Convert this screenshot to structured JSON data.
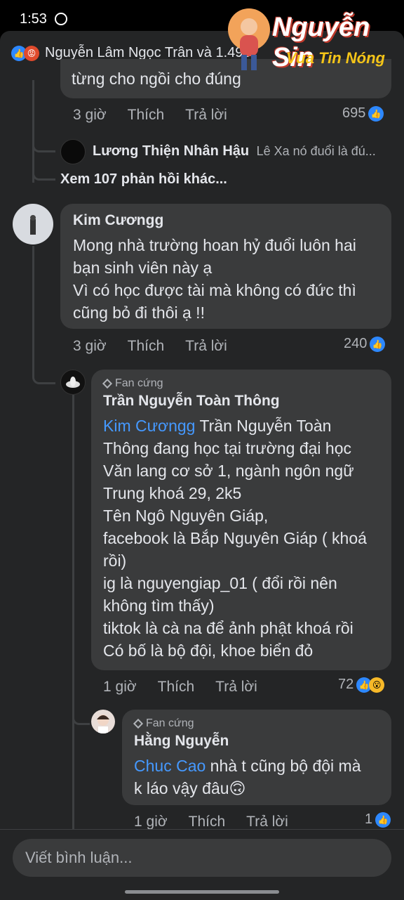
{
  "status_bar": {
    "time": "1:53"
  },
  "watermark": {
    "title": "Nguyễn Sin",
    "subtitle": "Vua Tin Nóng"
  },
  "header": {
    "reactors": "Nguyễn Lâm Ngọc Trân và 1.493"
  },
  "top_comment": {
    "partial_text": "từng cho ngồi cho đúng",
    "time": "3 giờ",
    "like": "Thích",
    "reply": "Trả lời",
    "count": "695"
  },
  "collapsed_reply": {
    "author": "Lương Thiện Nhân Hậu",
    "preview": "Lê Xa nó đuổi là đú..."
  },
  "more_replies": "Xem 107 phản hồi khác...",
  "comment1": {
    "author": "Kim Cươngg",
    "lines": [
      "Mong nhà trường hoan hỷ đuổi luôn hai",
      "bạn sinh viên này ạ",
      "Vì có học được tài mà không có đức thì",
      "cũng bỏ đi thôi ạ !!"
    ],
    "time": "3 giờ",
    "like": "Thích",
    "reply": "Trả lời",
    "count": "240"
  },
  "reply1": {
    "badge": "Fan cứng",
    "author": "Trần Nguyễn Toàn Thông",
    "mention": "Kim Cươngg",
    "first_line_rest": " Trần Nguyễn Toàn",
    "lines": [
      "Thông đang học tại trường đại học",
      "Văn lang cơ sở 1, ngành ngôn ngữ",
      "Trung khoá 29, 2k5",
      "Tên Ngô Nguyên Giáp,",
      "facebook là Bắp Nguyên Giáp ( khoá",
      "rồi)",
      "ig là nguyengiap_01 ( đổi rồi nên",
      "không tìm thấy)",
      "tiktok là cà na để ảnh phật khoá rồi",
      "Có bố là bộ đội, khoe biển đỏ"
    ],
    "time": "1 giờ",
    "like": "Thích",
    "reply": "Trả lời",
    "count": "72"
  },
  "reply2": {
    "badge": "Fan cứng",
    "author": "Hằng Nguyễn",
    "mention": "Chuc Cao",
    "first_line_rest": " nhà t cũng bộ đội mà",
    "line2": "k láo vậy đâu🙃",
    "time": "1 giờ",
    "like": "Thích",
    "reply": "Trả lời",
    "count": "1"
  },
  "input": {
    "placeholder": "Viết bình luận..."
  },
  "colors": {
    "accent": "#2d88ff",
    "mention": "#4599ff",
    "bubble": "#3a3b3c",
    "sheet": "#242526"
  }
}
